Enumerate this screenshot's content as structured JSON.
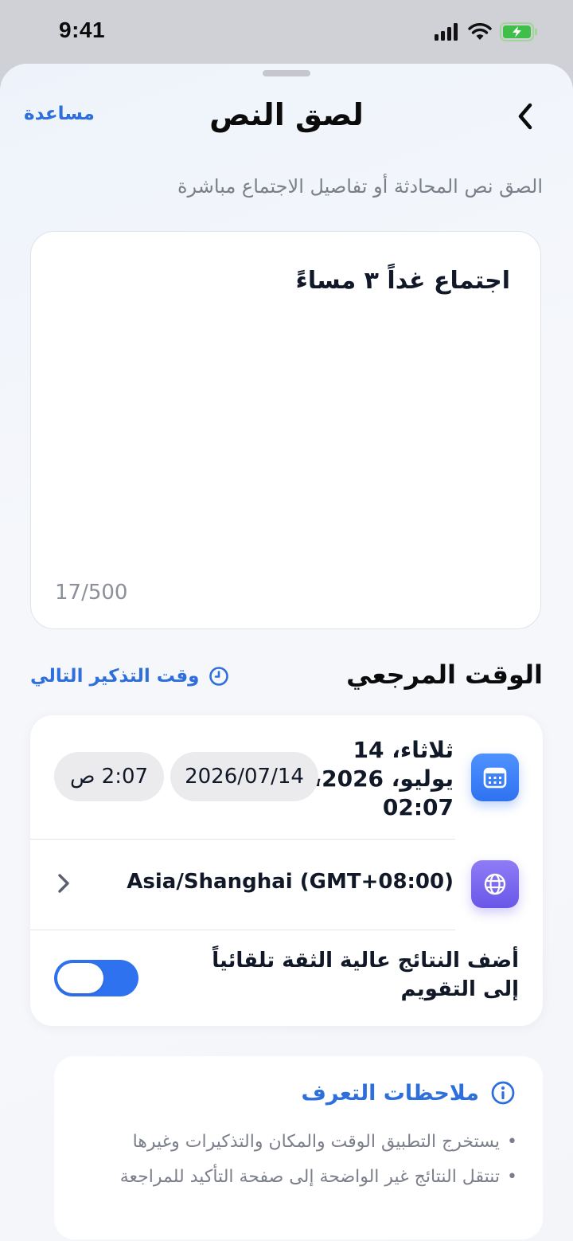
{
  "status_bar": {
    "time": "9:41"
  },
  "nav": {
    "title": "لصق النص",
    "help_label": "مساعدة"
  },
  "subtitle": "الصق نص المحادثة أو تفاصيل الاجتماع مباشرة",
  "text_input": {
    "value": "اجتماع غداً ٣ مساءً",
    "char_count": "17/500"
  },
  "reference_time": {
    "section_title": "الوقت المرجعي",
    "next_reminder_label": "وقت التذكير التالي",
    "datetime_lines": [
      "ثلاثاء، 14",
      "يوليو، 2026،",
      "02:07"
    ],
    "date_pill": "2026/07/14",
    "time_pill": "2:07 ص",
    "timezone": "Asia/Shanghai (GMT+08:00)",
    "auto_add_lines": [
      "أضف النتائج عالية الثقة تلقائياً",
      "إلى التقويم"
    ],
    "auto_add_enabled": true
  },
  "notes": {
    "title": "ملاحظات التعرف",
    "items": [
      "يستخرج التطبيق الوقت والمكان والتذكيرات وغيرها",
      "تنتقل النتائج غير الواضحة إلى صفحة التأكيد للمراجعة"
    ]
  },
  "colors": {
    "accent": "#2f72f0",
    "link": "#2f6fdc",
    "purple": "#6a57e8"
  },
  "icons": [
    "back-chevron-icon",
    "clock-icon",
    "calendar-icon",
    "globe-icon",
    "chevron-right-icon",
    "info-icon"
  ]
}
